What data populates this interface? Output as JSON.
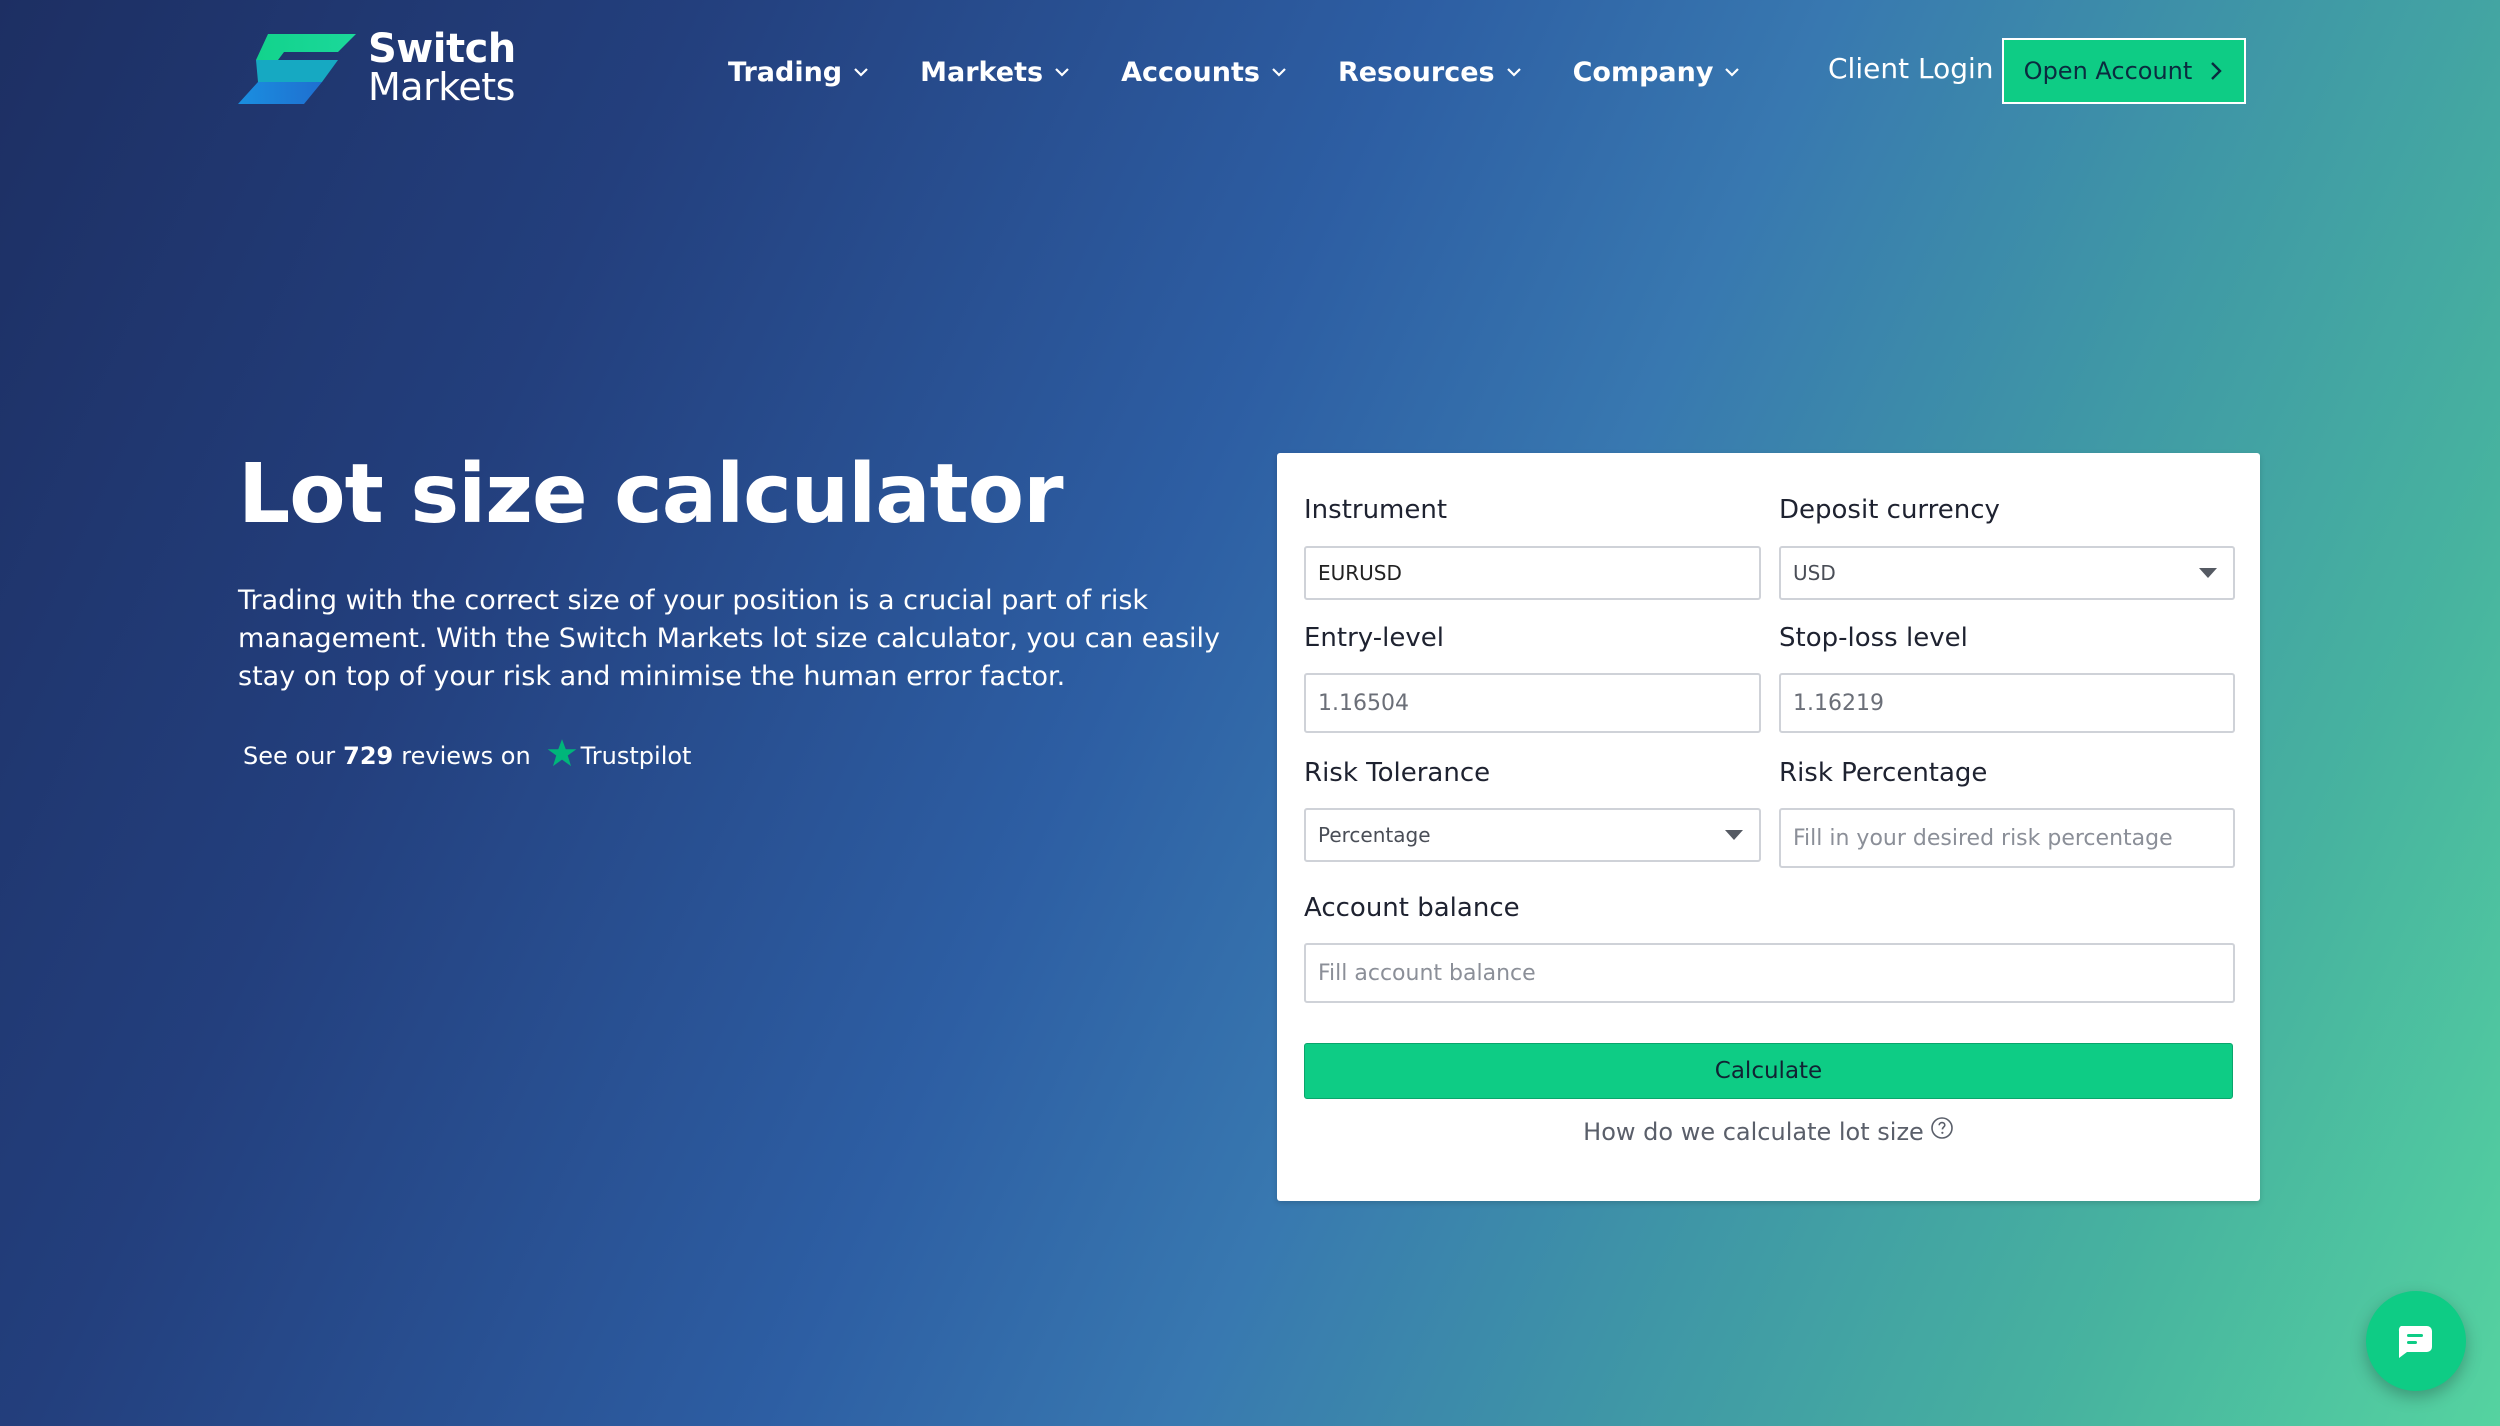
{
  "brand": {
    "line1": "Switch",
    "line2": "Markets",
    "colors": {
      "accent": "#0ecc85",
      "logo_blue": "#1f7fd6",
      "logo_green": "#12d38c"
    }
  },
  "nav": {
    "items": [
      {
        "label": "Trading"
      },
      {
        "label": "Markets"
      },
      {
        "label": "Accounts"
      },
      {
        "label": "Resources"
      },
      {
        "label": "Company"
      }
    ],
    "client_login": "Client Login",
    "open_account": "Open Account"
  },
  "hero": {
    "title": "Lot size calculator",
    "description": "Trading with the correct size of your position is a crucial part of risk management. With the Switch Markets lot size calculator, you can easily stay on top of your risk and minimise the human error factor.",
    "trustpilot": {
      "prefix": "See our",
      "count": "729",
      "suffix": "reviews on",
      "brand": "Trustpilot"
    }
  },
  "calculator": {
    "instrument": {
      "label": "Instrument",
      "value": "EURUSD"
    },
    "deposit_currency": {
      "label": "Deposit currency",
      "value": "USD"
    },
    "entry_level": {
      "label": "Entry-level",
      "value": "1.16504"
    },
    "stop_loss": {
      "label": "Stop-loss level",
      "value": "1.16219"
    },
    "risk_tolerance": {
      "label": "Risk Tolerance",
      "value": "Percentage"
    },
    "risk_percentage": {
      "label": "Risk Percentage",
      "placeholder": "Fill in your desired risk percentage"
    },
    "account_balance": {
      "label": "Account balance",
      "placeholder": "Fill account balance"
    },
    "calculate_label": "Calculate",
    "how_link": "How do we calculate lot size"
  },
  "icons": {
    "nav_dropdown": "chevron-down-icon",
    "open_account": "chevron-right-icon",
    "trustpilot": "star-icon",
    "help": "question-circle-icon",
    "chat": "chat-icon"
  }
}
